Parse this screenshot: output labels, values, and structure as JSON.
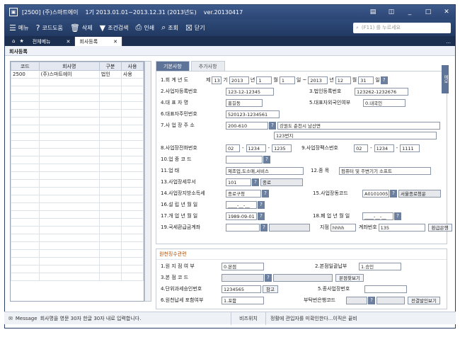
{
  "titlebar": {
    "company": "[2500] (주)스마트에이",
    "period": "1기 2013.01.01~2013.12.31 (2013년도)",
    "version": "ver.20130417"
  },
  "toolbar": {
    "menu": "메뉴",
    "code_help": "코드도움",
    "delete": "삭제",
    "condition_search": "조건검색",
    "print": "인쇄",
    "inquiry": "조회",
    "close": "닫기",
    "search_placeholder": "(F11) 를 누르세요"
  },
  "tabs": {
    "all_menu": "전체메뉴",
    "company_register": "회사등록"
  },
  "page_title": "회사등록",
  "left_table": {
    "headers": [
      "코드",
      "회사명",
      "구분",
      "사용"
    ],
    "rows": [
      [
        "2500",
        "(주)스마트에이",
        "법인",
        "사용"
      ]
    ]
  },
  "subtabs": {
    "basic": "기본사항",
    "extra": "추가사항"
  },
  "form": {
    "f1_label": "1.회 계 년 도",
    "f1_je": "제",
    "f1_gi_num": "13",
    "f1_gi": "기",
    "f1_y1": "2013",
    "f1_y1_unit": "년",
    "f1_m1": "1",
    "f1_m1_unit": "월",
    "f1_d1": "1",
    "f1_d1_unit": "일 ~",
    "f1_y2": "2013",
    "f1_y2_unit": "년",
    "f1_m2": "12",
    "f1_m2_unit": "월",
    "f1_d2": "31",
    "f1_d2_unit": "일",
    "f2_label": "2.사업자등록번호",
    "f2_val": "123-12-12345",
    "f3_label": "3.법인등록번호",
    "f3_val": "123262-1232676",
    "f4_label": "4.대 표 자 명",
    "f4_val": "홍길동",
    "f5_label": "5.대표자외국인여부",
    "f5_val": "0.내국인",
    "f6_label": "6.대표자주민번호",
    "f6_val": "520123-1234561",
    "f7_label": "7.사 업 장 주 소",
    "f7_zip": "200-610",
    "f7_addr1": "강원도 춘천시 남산면",
    "f7_addr2": "123번지",
    "f8_label": "8.사업장전화번호",
    "f8_a": "02",
    "f8_b": "1234",
    "f8_c": "1235",
    "f9_label": "9.사업장팩스번호",
    "f9_a": "02",
    "f9_b": "1234",
    "f9_c": "1111",
    "f10_label": "10.업 종 코 드",
    "f11_label": "11.업 태",
    "f11_val": "제조업,도소매,서비스",
    "f12_label": "12.종 목",
    "f12_val": "컴퓨터 및 주변기기 소프트",
    "f13_label": "13.사업장세무서",
    "f13_code": "101",
    "f13_name": "종로",
    "f14_label": "14.사업장지방소득세",
    "f14_val": "종로구청",
    "f15_label": "15.사업장동코드",
    "f15_code": "A0101005",
    "f15_name": "서울종로청운",
    "f16_label": "16.설 립 년 월 일",
    "f16_val": "____-__-__",
    "f17_label": "17.개 업 년 월 일",
    "f17_val": "1989-09-01",
    "f18_label": "18.폐 업 년 월 일",
    "f18_val": "____-__-__",
    "f19_label": "19.국세환급금계좌",
    "f19_branch": "지점",
    "f19_branch_val": "hhhh",
    "f19_acct": "계좌번호",
    "f19_acct_val": "135",
    "f19_btn": "환급은행"
  },
  "section2": {
    "title": "원천징수관련",
    "s1_label": "1.원 지 점 여 부",
    "s1_val": "0.본점",
    "s2_label": "2.본점일괄납부",
    "s2_val": "1.승인",
    "s3_label": "3.본 점 코 드",
    "s3_btn": "본점찾보기",
    "s4_label": "4.단위과세승인번호",
    "s4_val": "1234565",
    "s4_btn": "참고",
    "s5_label": "5.종사업장번호",
    "s6_label": "6.원천납세 포함여부",
    "s6_val": "1.포함",
    "s6_bank": "부탁번은행코드",
    "s6_btn": "전결발인보기"
  },
  "sidetab": "메모",
  "status": {
    "msg_label": "Message",
    "msg_text": "회사명을 영문 30자 한글 30자 내로 입력합니다.",
    "biz": "비즈위치",
    "note": "정활에 관입자를 미확인한다...이직은 끝비"
  }
}
